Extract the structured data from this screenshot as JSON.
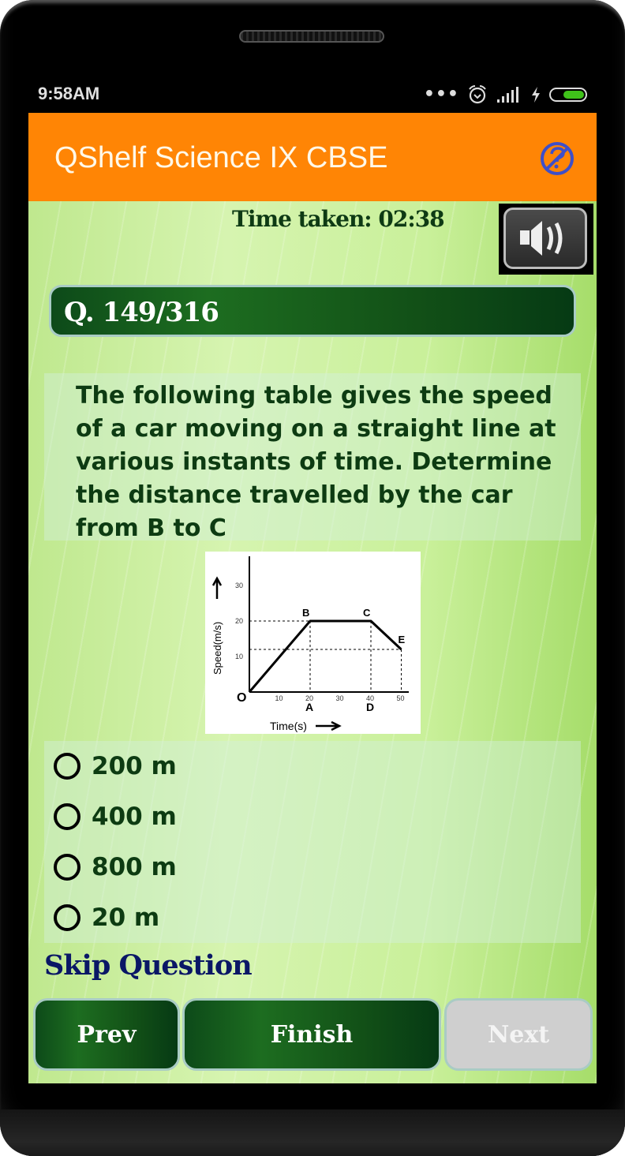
{
  "status_bar": {
    "time": "9:58AM",
    "more_icon": "dots-icon",
    "alarm_icon": "alarm-icon",
    "signal_icon": "signal-icon",
    "charging_icon": "bolt-icon",
    "battery_icon": "battery-icon"
  },
  "app_bar": {
    "title": "QShelf Science IX CBSE",
    "help_icon": "help-disabled-icon",
    "background": "#ff8505"
  },
  "quiz": {
    "timer_label": "Time taken: 02:38",
    "sound_icon": "speaker-icon",
    "question_number": "Q. 149/316",
    "question_text": "The following table gives the speed of a car moving on a straight line at various instants of time. Determine the distance travelled by the car from B to C",
    "options": [
      {
        "label": "200 m",
        "selected": false
      },
      {
        "label": "400 m",
        "selected": false
      },
      {
        "label": "800 m",
        "selected": false
      },
      {
        "label": "20 m",
        "selected": false
      }
    ],
    "skip_label": "Skip Question"
  },
  "nav": {
    "prev": "Prev",
    "finish": "Finish",
    "next": "Next",
    "next_enabled": false
  },
  "figure": {
    "ylabel": "Speed(m/s)",
    "xlabel": "Time(s)",
    "x_ticks": [
      "10",
      "20",
      "30",
      "40",
      "50"
    ],
    "y_ticks": [
      "10",
      "20",
      "30"
    ],
    "origin_label": "O",
    "points": [
      {
        "label": "O",
        "t": 0,
        "v": 0
      },
      {
        "label": "B",
        "t": 20,
        "v": 20
      },
      {
        "label": "C",
        "t": 40,
        "v": 20
      },
      {
        "label": "E",
        "t": 50,
        "v": 12
      }
    ],
    "x_point_labels": [
      {
        "label": "A",
        "t": 20
      },
      {
        "label": "D",
        "t": 40
      }
    ]
  }
}
